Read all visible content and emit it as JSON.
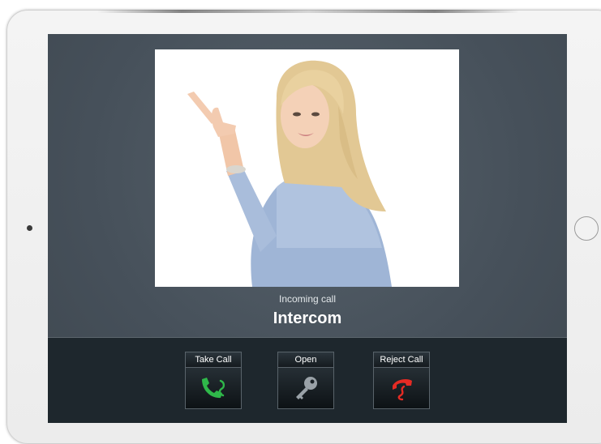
{
  "call": {
    "status": "Incoming call",
    "caller": "Intercom"
  },
  "actions": [
    {
      "label": "Take Call",
      "icon": "phone-answer-icon",
      "color": "#2fb84a"
    },
    {
      "label": "Open",
      "icon": "key-icon",
      "color": "#9aa2a8"
    },
    {
      "label": "Reject Call",
      "icon": "phone-reject-icon",
      "color": "#e52b24"
    }
  ],
  "colors": {
    "screen_background": "#454f57",
    "action_bar": "#1e272d"
  }
}
